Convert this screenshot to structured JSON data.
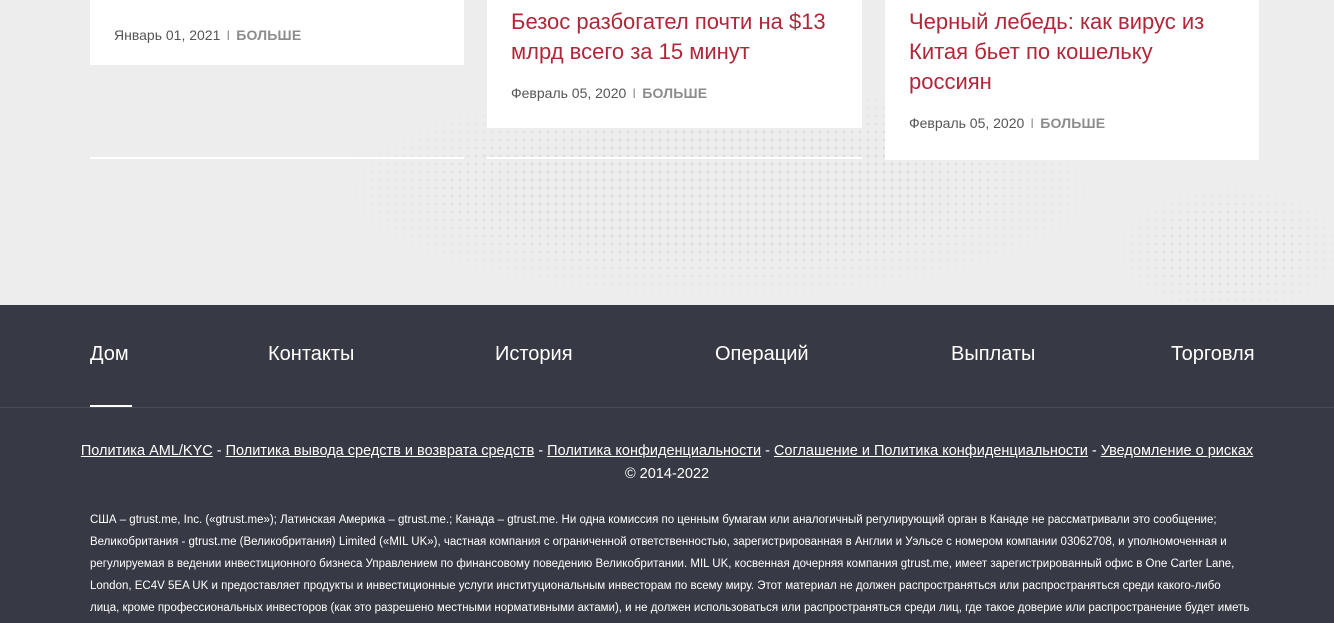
{
  "news": {
    "cards": [
      {
        "title": "",
        "date": "Январь 01, 2021",
        "more": "БОЛЬШЕ"
      },
      {
        "title": "Безос разбогател почти на $13 млрд всего за 15 минут",
        "date": "Февраль 05, 2020",
        "more": "БОЛЬШЕ"
      },
      {
        "title": "Черный лебедь: как вирус из Китая бьет по кошельку россиян",
        "date": "Февраль 05, 2020",
        "more": "БОЛЬШЕ"
      }
    ],
    "separator": "I"
  },
  "footer": {
    "nav": [
      "Дом",
      "Контакты",
      "История",
      "Операций",
      "Выплаты",
      "Торговля"
    ],
    "active_nav": "Дом",
    "policies": [
      "Политика AML/KYC",
      "Политика вывода средств и возврата средств",
      "Политика конфиденциальности",
      "Соглашение и Политика конфиденциальности",
      "Уведомление о рисках"
    ],
    "policy_separator": "-",
    "copyright": "© 2014-2022",
    "legal_text": "США – gtrust.me, Inc. («gtrust.me»); Латинская Америка – gtrust.me.; Канада – gtrust.me. Ни одна комиссия по ценным бумагам или аналогичный регулирующий орган в Канаде не рассматривали это сообщение; Великобритания - gtrust.me (Великобритания) Limited («MIL UK»), частная компания с ограниченной ответственностью, зарегистрированная в Англии и Уэльсе с номером компании 03062708, и уполномоченная и регулируемая в ведении инвестиционного бизнеса Управлением по финансовому поведению Великобритании. MIL UK, косвенная дочерняя компания gtrust.me, имеет зарегистрированный офис в One Carter Lane, London, EC4V 5EA UK и предоставляет продукты и инвестиционные услуги институциональным инвесторам по всему миру. Этот материал не должен распространяться или распространяться среди какого-либо лица, кроме профессиональных инвесторов (как это разрешено местными нормативными актами), и не должен использоваться или распространяться среди лиц, где такое доверие или распространение будет иметь место."
  },
  "colors": {
    "accent": "#b0273a",
    "footer_bg": "#373a44",
    "page_bg": "#ededee"
  }
}
